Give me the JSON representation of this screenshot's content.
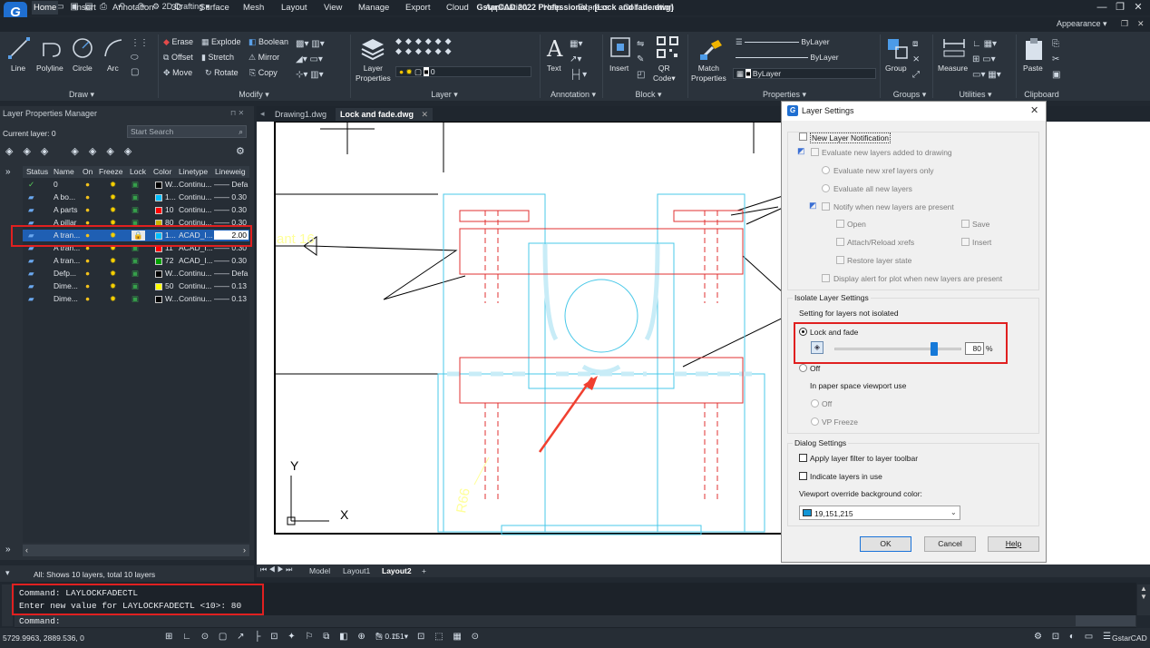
{
  "app": {
    "window_title": "GstarCAD 2022 Professional - [Lock and fade.dwg]",
    "logo_letter": "G",
    "workspace": "2D Drafting",
    "appearance": "Appearance"
  },
  "menu": [
    "Home",
    "Insert",
    "Annotation",
    "3D",
    "Surface",
    "Mesh",
    "Layout",
    "View",
    "Manage",
    "Export",
    "Cloud",
    "Application",
    "Help",
    "Express",
    "Collaboration"
  ],
  "ribbon": {
    "draw": {
      "title": "Draw",
      "line": "Line",
      "polyline": "Polyline",
      "circle": "Circle",
      "arc": "Arc"
    },
    "modify": {
      "title": "Modify",
      "erase": "Erase",
      "explode": "Explode",
      "boolean": "Boolean",
      "offset": "Offset",
      "stretch": "Stretch",
      "mirror": "Mirror",
      "move": "Move",
      "rotate": "Rotate",
      "copy": "Copy"
    },
    "layer": {
      "title": "Layer",
      "layer_properties_l1": "Layer",
      "layer_properties_l2": "Properties",
      "current_layer": "0"
    },
    "annotation": {
      "title": "Annotation",
      "text": "Text"
    },
    "block": {
      "title": "Block",
      "insert": "Insert",
      "qr_l1": "QR",
      "qr_l2": "Code"
    },
    "properties": {
      "title": "Properties",
      "match_l1": "Match",
      "match_l2": "Properties",
      "bylayer1": "ByLayer",
      "bylayer2": "ByLayer",
      "bylayer3": "ByLayer"
    },
    "groups": {
      "title": "Groups",
      "group": "Group"
    },
    "utilities": {
      "title": "Utilities",
      "measure": "Measure"
    },
    "clipboard": {
      "title": "Clipboard",
      "paste": "Paste"
    }
  },
  "layer_manager": {
    "title": "Layer Properties Manager",
    "current_layer": "Current layer: 0",
    "search_placeholder": "Start Search",
    "columns": [
      "Status",
      "Name",
      "On",
      "Freeze",
      "Lock",
      "Color",
      "Linetype",
      "Lineweig"
    ],
    "rows": [
      {
        "status": "current",
        "name": "0",
        "color_hex": "#000000",
        "color": "W...",
        "linetype": "Continu...",
        "lineweight": "Defa",
        "locked": false,
        "selected": false
      },
      {
        "status": "layer",
        "name": "A bo...",
        "color_hex": "#00bfff",
        "color": "1...",
        "linetype": "Continu...",
        "lineweight": "0.30",
        "locked": false,
        "selected": false
      },
      {
        "status": "layer",
        "name": "A parts",
        "color_hex": "#ff0000",
        "color": "10",
        "linetype": "Continu...",
        "lineweight": "0.30",
        "locked": false,
        "selected": false
      },
      {
        "status": "layer",
        "name": "A pillar",
        "color_hex": "#c8b400",
        "color": "80",
        "linetype": "Continu...",
        "lineweight": "0.30",
        "locked": false,
        "selected": false
      },
      {
        "status": "layer",
        "name": "A tran...",
        "color_hex": "#00bfff",
        "color": "1...",
        "linetype": "ACAD_I...",
        "lineweight": "2.00",
        "locked": true,
        "selected": true
      },
      {
        "status": "layer",
        "name": "A tran...",
        "color_hex": "#ff0000",
        "color": "11",
        "linetype": "ACAD_I...",
        "lineweight": "0.30",
        "locked": false,
        "selected": false
      },
      {
        "status": "layer",
        "name": "A tran...",
        "color_hex": "#00a000",
        "color": "72",
        "linetype": "ACAD_I...",
        "lineweight": "0.30",
        "locked": false,
        "selected": false
      },
      {
        "status": "layer",
        "name": "Defp...",
        "color_hex": "#000000",
        "color": "W...",
        "linetype": "Continu...",
        "lineweight": "Defa",
        "locked": false,
        "selected": false
      },
      {
        "status": "layer",
        "name": "Dime...",
        "color_hex": "#ffff00",
        "color": "50",
        "linetype": "Continu...",
        "lineweight": "0.13",
        "locked": false,
        "selected": false
      },
      {
        "status": "layer",
        "name": "Dime...",
        "color_hex": "#000000",
        "color": "W...",
        "linetype": "Continu...",
        "lineweight": "0.13",
        "locked": false,
        "selected": false
      }
    ],
    "footer": "All: Shows 10 layers, total 10 layers"
  },
  "doc_tabs": [
    "Drawing1.dwg",
    "Lock and fade.dwg"
  ],
  "layout_tabs": [
    "Model",
    "Layout1",
    "Layout2"
  ],
  "drawing": {
    "text1": "ant 16",
    "text2": "R66",
    "ucs_x": "X",
    "ucs_y": "Y"
  },
  "dialog": {
    "title": "Layer Settings",
    "new_layer_notification": "New Layer Notification",
    "evaluate_new_layers": "Evaluate new layers added to drawing",
    "evaluate_xref_only": "Evaluate new xref layers only",
    "evaluate_all": "Evaluate all new layers",
    "notify_present": "Notify when new layers are present",
    "open": "Open",
    "save": "Save",
    "attach_reload": "Attach/Reload xrefs",
    "insert": "Insert",
    "restore_state": "Restore layer state",
    "display_alert": "Display alert for plot when new layers are present",
    "isolate_title": "Isolate Layer Settings",
    "setting_not_isolated": "Setting for layers not isolated",
    "lock_and_fade": "Lock and fade",
    "fade_value": "80",
    "fade_unit": "%",
    "fade_fraction": 0.8,
    "off": "Off",
    "paper_space": "In paper space viewport use",
    "ps_off": "Off",
    "vp_freeze": "VP Freeze",
    "dialog_settings": "Dialog Settings",
    "apply_filter": "Apply layer filter to layer toolbar",
    "indicate_layers": "Indicate layers in use",
    "viewport_bg": "Viewport override background color:",
    "bg_color": "19,151,215",
    "bg_color_hex": "#1397d7",
    "ok": "OK",
    "cancel": "Cancel",
    "help": "Help"
  },
  "command": {
    "line1": "Command: LAYLOCKFADECTL",
    "line2": "Enter new value for LAYLOCKFADECTL <10>: 80",
    "prompt": "Command:"
  },
  "status": {
    "coords": "5729.9963, 2889.536, 0",
    "scale": "0.151",
    "brand": "GstarCAD"
  }
}
